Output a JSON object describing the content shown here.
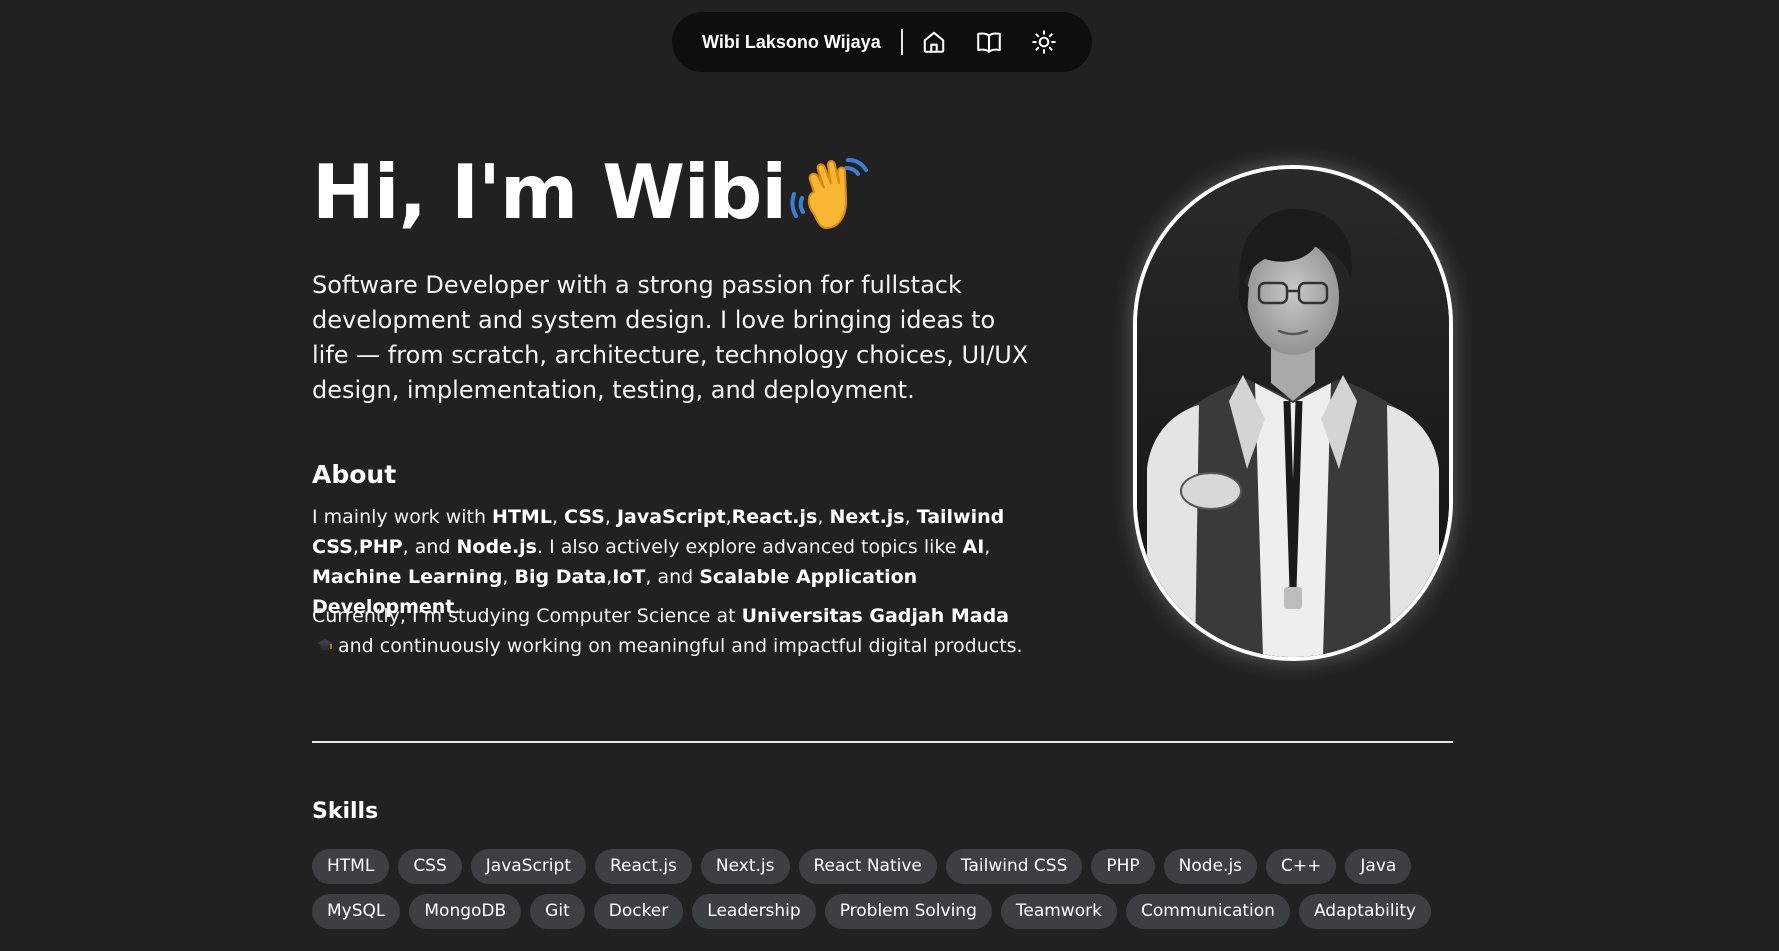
{
  "nav": {
    "brand": "Wibi Laksono Wijaya",
    "icons": [
      "home-icon",
      "book-icon",
      "sun-icon"
    ]
  },
  "hero": {
    "greeting": "Hi, I'm Wibi",
    "emoji": "waving-hand-emoji",
    "intro": "Software Developer with a strong passion for fullstack development and system design. I love bringing ideas to life — from scratch, architecture, technology choices, UI/UX design, implementation, testing, and deployment."
  },
  "about": {
    "heading": "About",
    "p1": {
      "lead": "I mainly work with ",
      "html": "HTML",
      "sep1": ", ",
      "css": "CSS",
      "sep2": ", ",
      "javascript": "JavaScript",
      "sep3": ",",
      "react": "React.js",
      "sep4": ", ",
      "next": "Next.js",
      "sep5": ", ",
      "tailwind": "Tailwind CSS",
      "sep6": ",",
      "php": "PHP",
      "sep7": ", and ",
      "node": "Node.js",
      "mid": ". I also actively explore advanced topics like ",
      "ai": "AI",
      "sep8": ", ",
      "ml": "Machine Learning",
      "sep9": ", ",
      "bigdata": "Big Data",
      "sep10": ",",
      "iot": "IoT",
      "sep11": ", and ",
      "scalable": "Scalable Application Development",
      "end": "."
    },
    "p2": {
      "lead": "Currently, I’m studying Computer Science at ",
      "university": "Universitas Gadjah Mada",
      "emoji": "graduation-cap-emoji",
      "tail": "and continuously working on meaningful and impactful digital products."
    }
  },
  "portrait": {
    "icon": "profile-photo"
  },
  "skills": {
    "heading": "Skills",
    "items": [
      "HTML",
      "CSS",
      "JavaScript",
      "React.js",
      "Next.js",
      "React Native",
      "Tailwind CSS",
      "PHP",
      "Node.js",
      "C++",
      "Java",
      "MySQL",
      "MongoDB",
      "Git",
      "Docker",
      "Leadership",
      "Problem Solving",
      "Teamwork",
      "Communication",
      "Adaptability"
    ]
  },
  "colors": {
    "background": "#202120",
    "nav_background": "#0e0e0e",
    "chip_background": "#3e3f41",
    "text": "#ffffff"
  }
}
